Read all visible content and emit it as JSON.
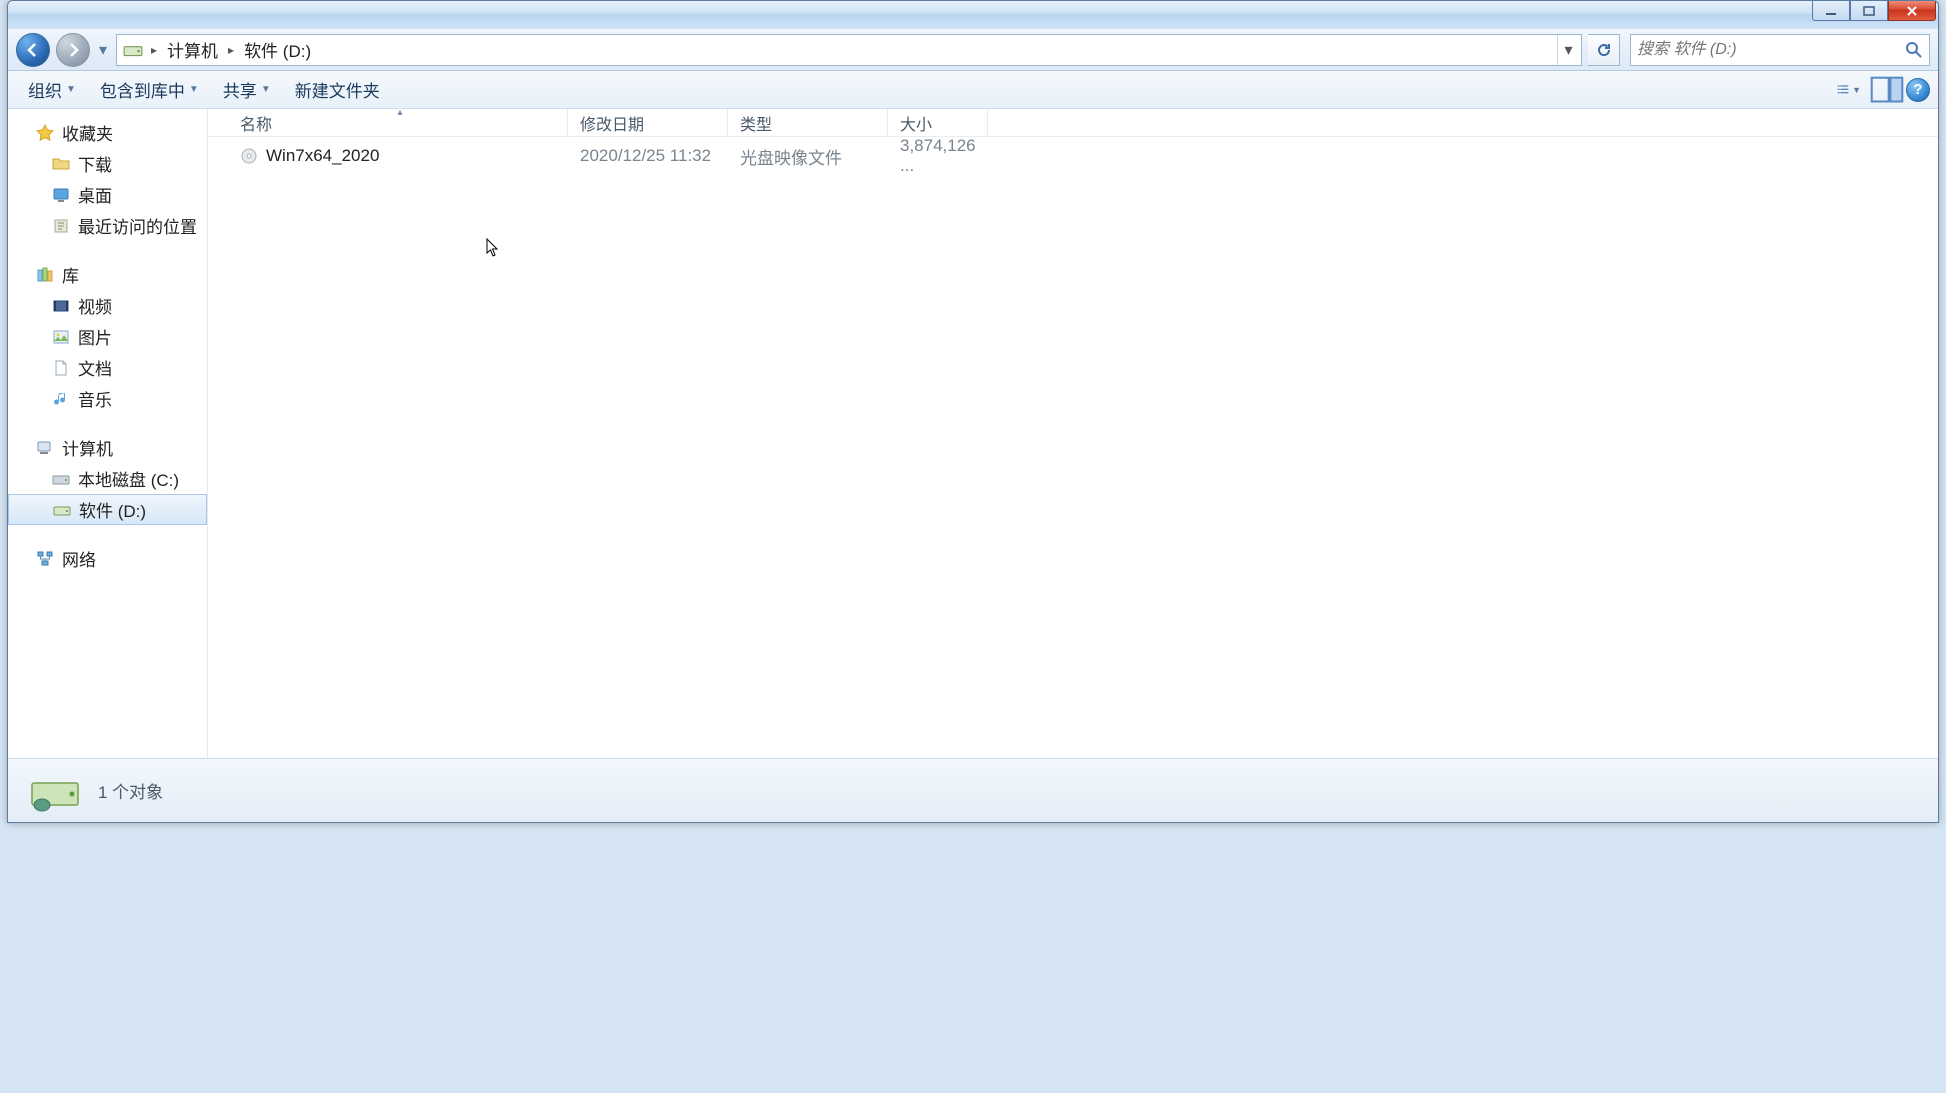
{
  "breadcrumb": {
    "computer": "计算机",
    "drive": "软件 (D:)"
  },
  "search": {
    "placeholder": "搜索 软件 (D:)"
  },
  "toolbar": {
    "organize": "组织",
    "include": "包含到库中",
    "share": "共享",
    "newfolder": "新建文件夹"
  },
  "columns": {
    "name": "名称",
    "date": "修改日期",
    "type": "类型",
    "size": "大小"
  },
  "sidebar": {
    "favorites": {
      "header": "收藏夹",
      "items": [
        "下载",
        "桌面",
        "最近访问的位置"
      ]
    },
    "library": {
      "header": "库",
      "items": [
        "视频",
        "图片",
        "文档",
        "音乐"
      ]
    },
    "computer": {
      "header": "计算机",
      "items": [
        "本地磁盘 (C:)",
        "软件 (D:)"
      ]
    },
    "network": {
      "header": "网络"
    }
  },
  "files": [
    {
      "name": "Win7x64_2020",
      "date": "2020/12/25 11:32",
      "type": "光盘映像文件",
      "size": "3,874,126 ..."
    }
  ],
  "status": {
    "count": "1 个对象"
  }
}
